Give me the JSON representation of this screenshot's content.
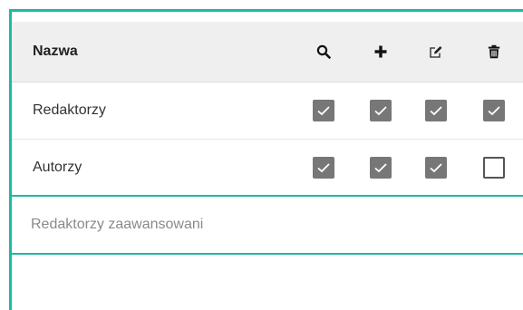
{
  "table": {
    "header": {
      "name_label": "Nazwa",
      "icons": [
        "search-icon",
        "plus-icon",
        "edit-icon",
        "trash-icon"
      ]
    },
    "rows": [
      {
        "name": "Redaktorzy",
        "permissions": [
          true,
          true,
          true,
          true
        ]
      },
      {
        "name": "Autorzy",
        "permissions": [
          true,
          true,
          true,
          false
        ]
      }
    ],
    "new_row": {
      "placeholder": "Redaktorzy zaawansowani",
      "value": ""
    }
  },
  "colors": {
    "accent": "#1fbaa0",
    "header_bg": "#efefef",
    "checkbox_checked": "#777777"
  }
}
